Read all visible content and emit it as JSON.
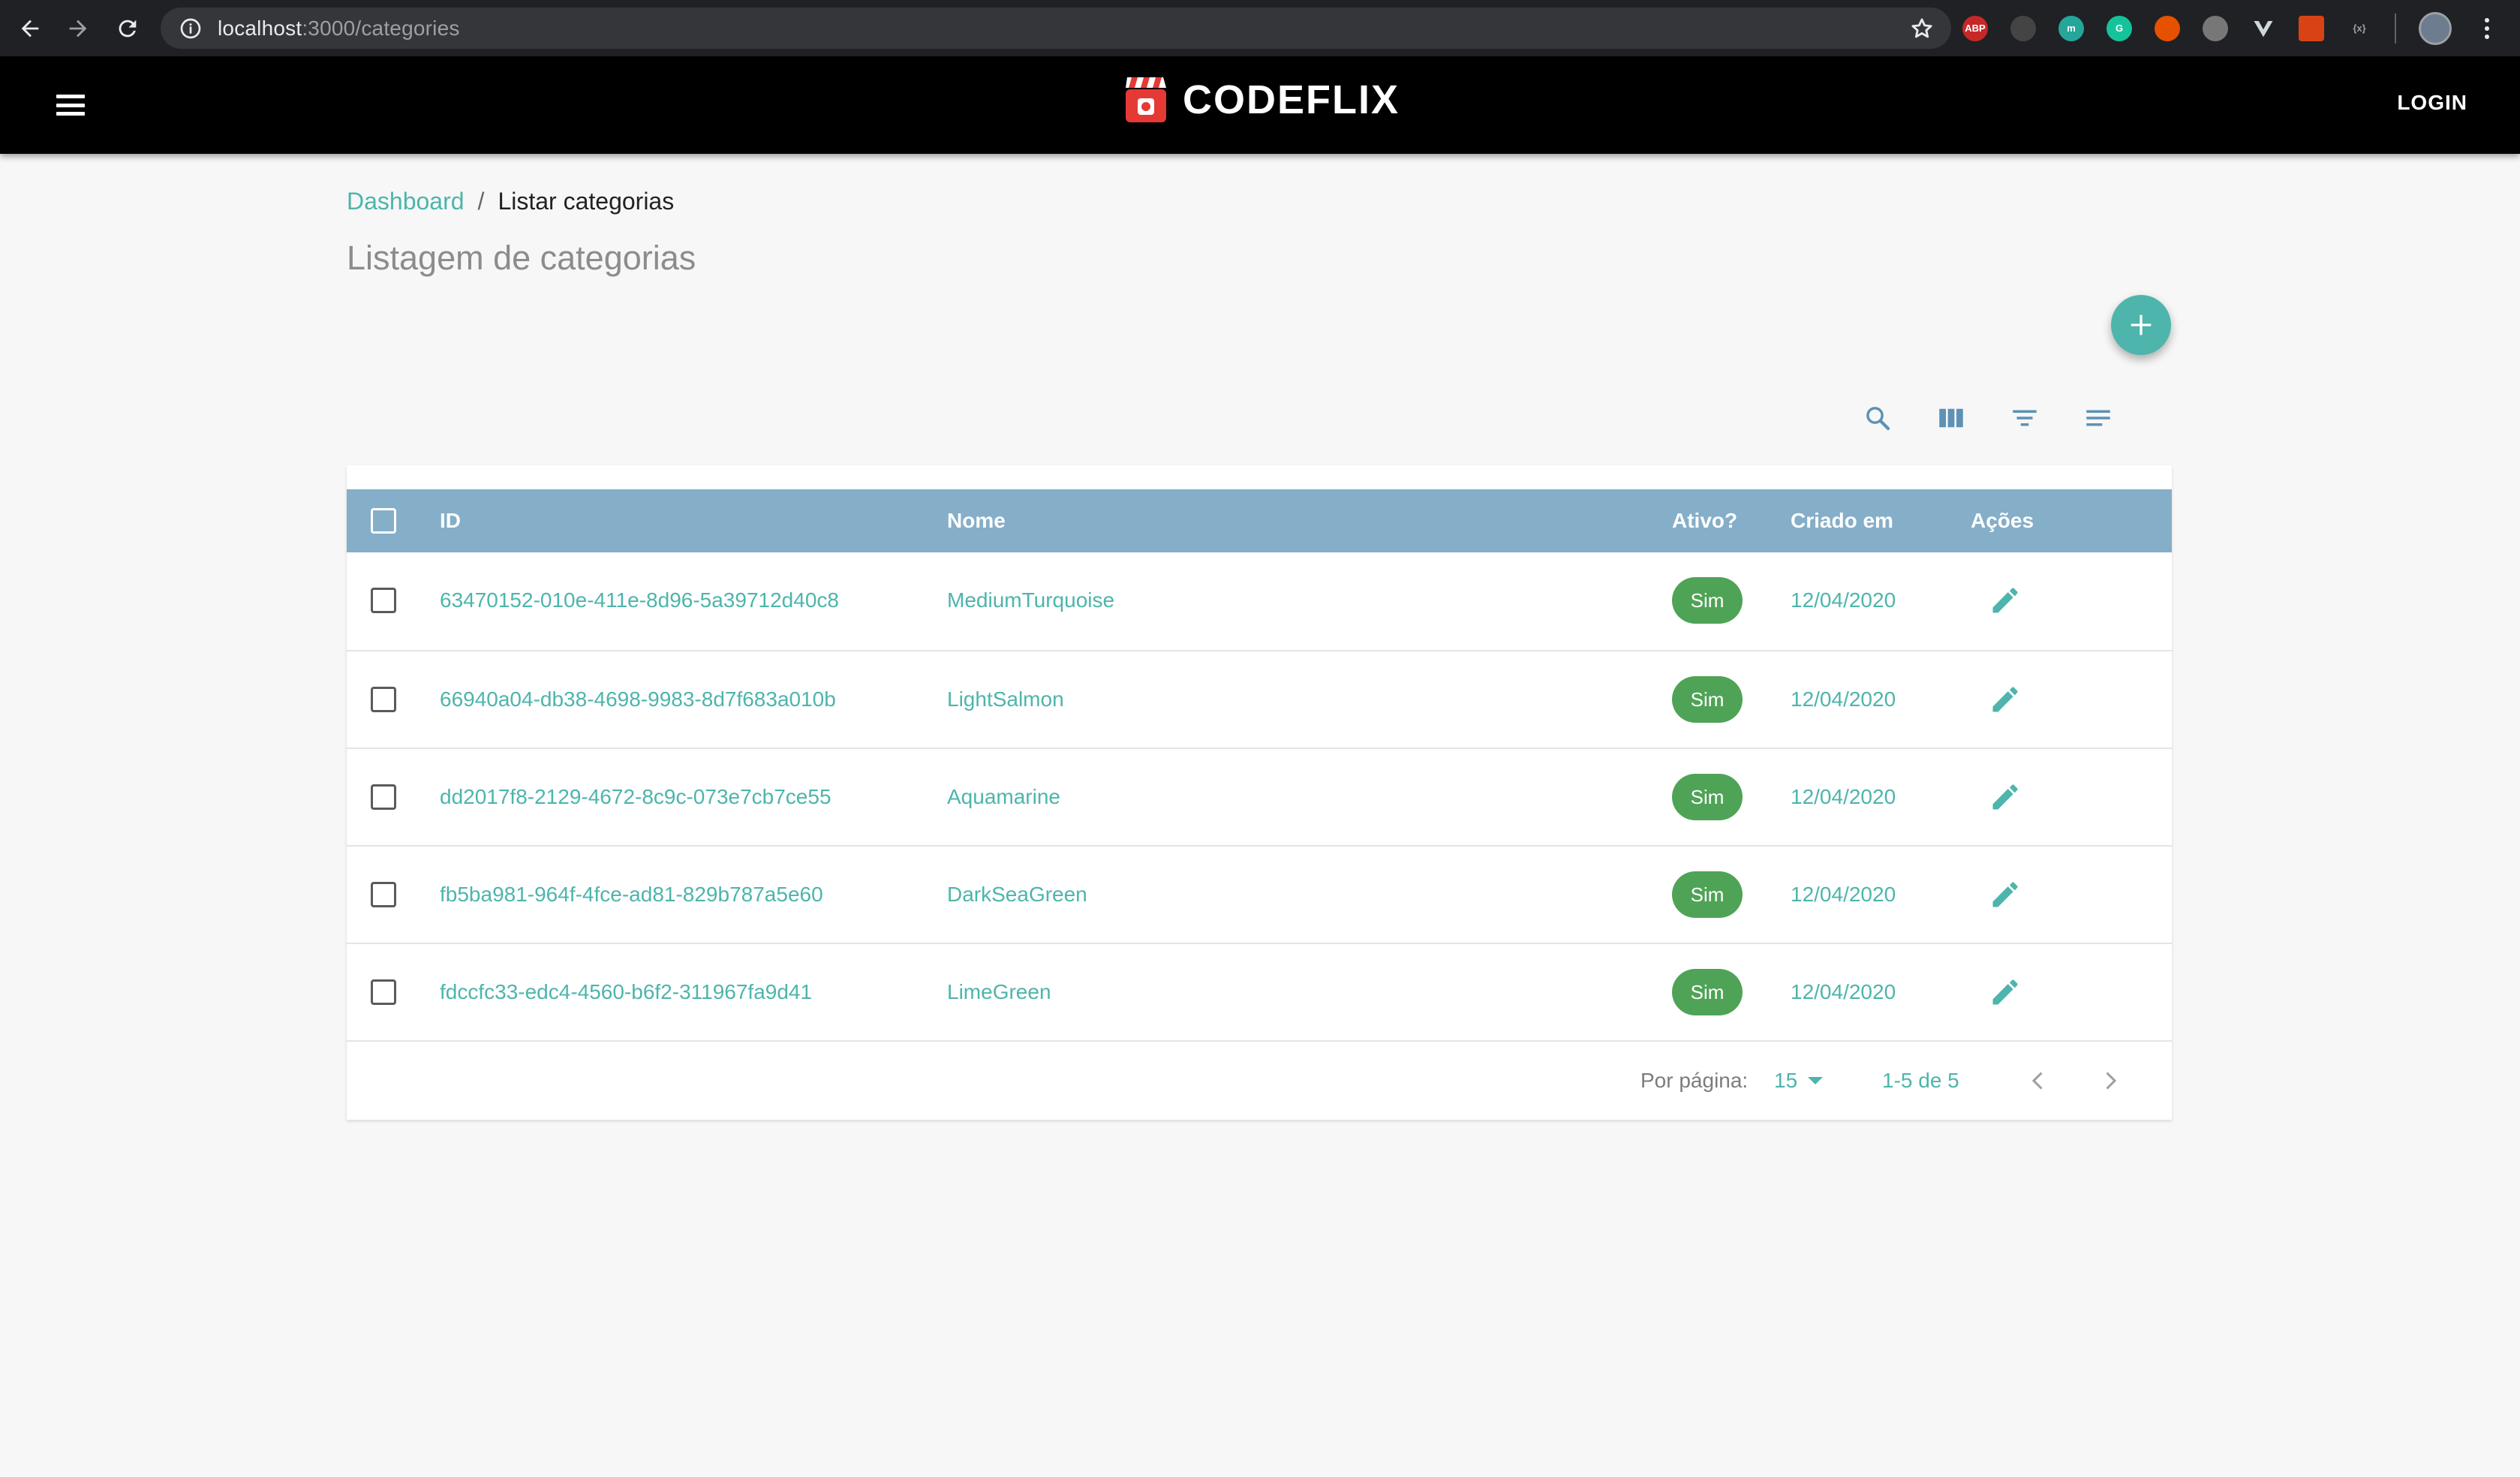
{
  "browser": {
    "url_host": "localhost",
    "url_path": ":3000/categories"
  },
  "appbar": {
    "brand": "CODEFLIX",
    "login_label": "LOGIN"
  },
  "breadcrumb": {
    "link": "Dashboard",
    "separator": "/",
    "current": "Listar categorias"
  },
  "page": {
    "title": "Listagem de categorias"
  },
  "table": {
    "columns": {
      "id": "ID",
      "nome": "Nome",
      "ativo": "Ativo?",
      "criado_em": "Criado em",
      "acoes": "Ações"
    },
    "rows": [
      {
        "id": "63470152-010e-411e-8d96-5a39712d40c8",
        "nome": "MediumTurquoise",
        "ativo": "Sim",
        "criado_em": "12/04/2020"
      },
      {
        "id": "66940a04-db38-4698-9983-8d7f683a010b",
        "nome": "LightSalmon",
        "ativo": "Sim",
        "criado_em": "12/04/2020"
      },
      {
        "id": "dd2017f8-2129-4672-8c9c-073e7cb7ce55",
        "nome": "Aquamarine",
        "ativo": "Sim",
        "criado_em": "12/04/2020"
      },
      {
        "id": "fb5ba981-964f-4fce-ad81-829b787a5e60",
        "nome": "DarkSeaGreen",
        "ativo": "Sim",
        "criado_em": "12/04/2020"
      },
      {
        "id": "fdccfc33-edc4-4560-b6f2-311967fa9d41",
        "nome": "LimeGreen",
        "ativo": "Sim",
        "criado_em": "12/04/2020"
      }
    ],
    "pagination": {
      "per_page_label": "Por página:",
      "per_page_value": "15",
      "range": "1-5 de 5"
    }
  },
  "colors": {
    "accent": "#4db5ab",
    "header": "#85aec8",
    "chip": "#4fa356",
    "appbar": "#000000"
  }
}
